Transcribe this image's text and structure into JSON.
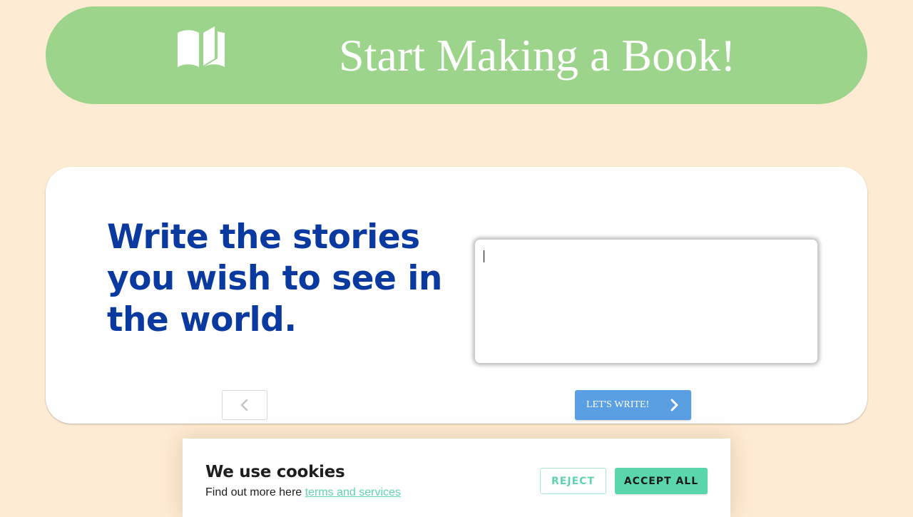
{
  "header": {
    "title": "Start Making a Book!",
    "icon": "book-open-icon"
  },
  "main": {
    "headline": "Write the stories you wish to see in the world.",
    "story_input": {
      "value": "",
      "placeholder": ""
    },
    "prev_icon": "chevron-left-icon",
    "next_button": {
      "label": "LET'S WRITE!",
      "icon": "chevron-right-icon"
    }
  },
  "cookie_banner": {
    "title": "We use cookies",
    "text": "Find out more here",
    "link_text": "terms and services",
    "reject_label": "REJECT",
    "accept_label": "ACCEPT ALL"
  },
  "colors": {
    "background": "#fdebd3",
    "banner": "#9dd48b",
    "headline": "#0a3aa0",
    "primary_button": "#5b9fe3",
    "accent": "#5ad6ac"
  }
}
